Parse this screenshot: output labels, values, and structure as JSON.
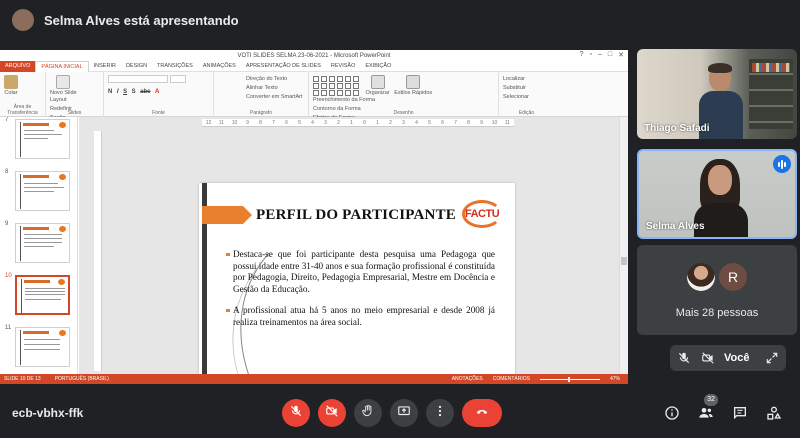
{
  "presenter": {
    "text": "Selma Alves está apresentando"
  },
  "powerpoint": {
    "window_title": "VOTI SLIDES SELMA 23-06-2021 - Microsoft PowerPoint",
    "tabs": [
      "ARQUIVO",
      "PÁGINA INICIAL",
      "INSERIR",
      "DESIGN",
      "TRANSIÇÕES",
      "ANIMAÇÕES",
      "APRESENTAÇÃO DE SLIDES",
      "REVISÃO",
      "EXIBIÇÃO"
    ],
    "ribbon": {
      "clipboard": {
        "paste": "Colar",
        "group": "Área de Transferência"
      },
      "slides": {
        "new_slide": "Novo Slide",
        "layout": "Layout",
        "reset": "Redefinir",
        "section": "Seção",
        "group": "Slides"
      },
      "font": {
        "group": "Fonte"
      },
      "paragraph": {
        "text_direction": "Direção do Texto",
        "align_text": "Alinhar Texto",
        "convert_smartart": "Converter em SmartArt",
        "group": "Parágrafo"
      },
      "drawing": {
        "arrange": "Organizar",
        "quick_styles": "Estilos Rápidos",
        "shape_fill": "Preenchimento da Forma",
        "shape_outline": "Contorno da Forma",
        "shape_effects": "Efeitos de Forma",
        "group": "Desenho"
      },
      "editing": {
        "find": "Localizar",
        "replace": "Substituir",
        "select": "Selecionar",
        "group": "Edição"
      }
    },
    "ruler_ticks": [
      "12",
      "11",
      "10",
      "9",
      "8",
      "7",
      "6",
      "5",
      "4",
      "3",
      "2",
      "1",
      "0",
      "1",
      "2",
      "3",
      "4",
      "5",
      "6",
      "7",
      "8",
      "9",
      "10",
      "11",
      "12"
    ],
    "thumbnails": [
      {
        "num": "7",
        "selected": false
      },
      {
        "num": "8",
        "selected": false
      },
      {
        "num": "9",
        "selected": false
      },
      {
        "num": "10",
        "selected": true
      },
      {
        "num": "11",
        "selected": false
      }
    ],
    "slide": {
      "title": "PERFIL DO PARTICIPANTE",
      "logo": "FACTU",
      "bullet1": "Destaca-se que foi participante desta pesquisa uma Pedagoga que possui idade entre 31-40 anos e sua formação profissional é constituída por Pedagogia, Direito, Pedagogia Empresarial, Mestre em Docência e Gestão da Educação.",
      "bullet2": "A profissional atua há 5 anos no meio empresarial e desde 2008 já realiza treinamentos na área social."
    },
    "status": {
      "slide": "SLIDE 10 DE 13",
      "language": "PORTUGUÊS (BRASIL)",
      "notes": "ANOTAÇÕES",
      "comments": "COMENTÁRIOS",
      "zoom": "47%"
    }
  },
  "participants": {
    "thiago": "Thiago Safadi",
    "selma": "Selma Alves",
    "more": "Mais 28 pessoas",
    "more_initial": "R",
    "self": "Você"
  },
  "meeting": {
    "code": "ecb-vbhx-ffk",
    "people_count": "32"
  },
  "colors": {
    "accent": "#d24726",
    "orange": "#e8802e",
    "hangup": "#ea4335",
    "speaking": "#1a73e8"
  }
}
